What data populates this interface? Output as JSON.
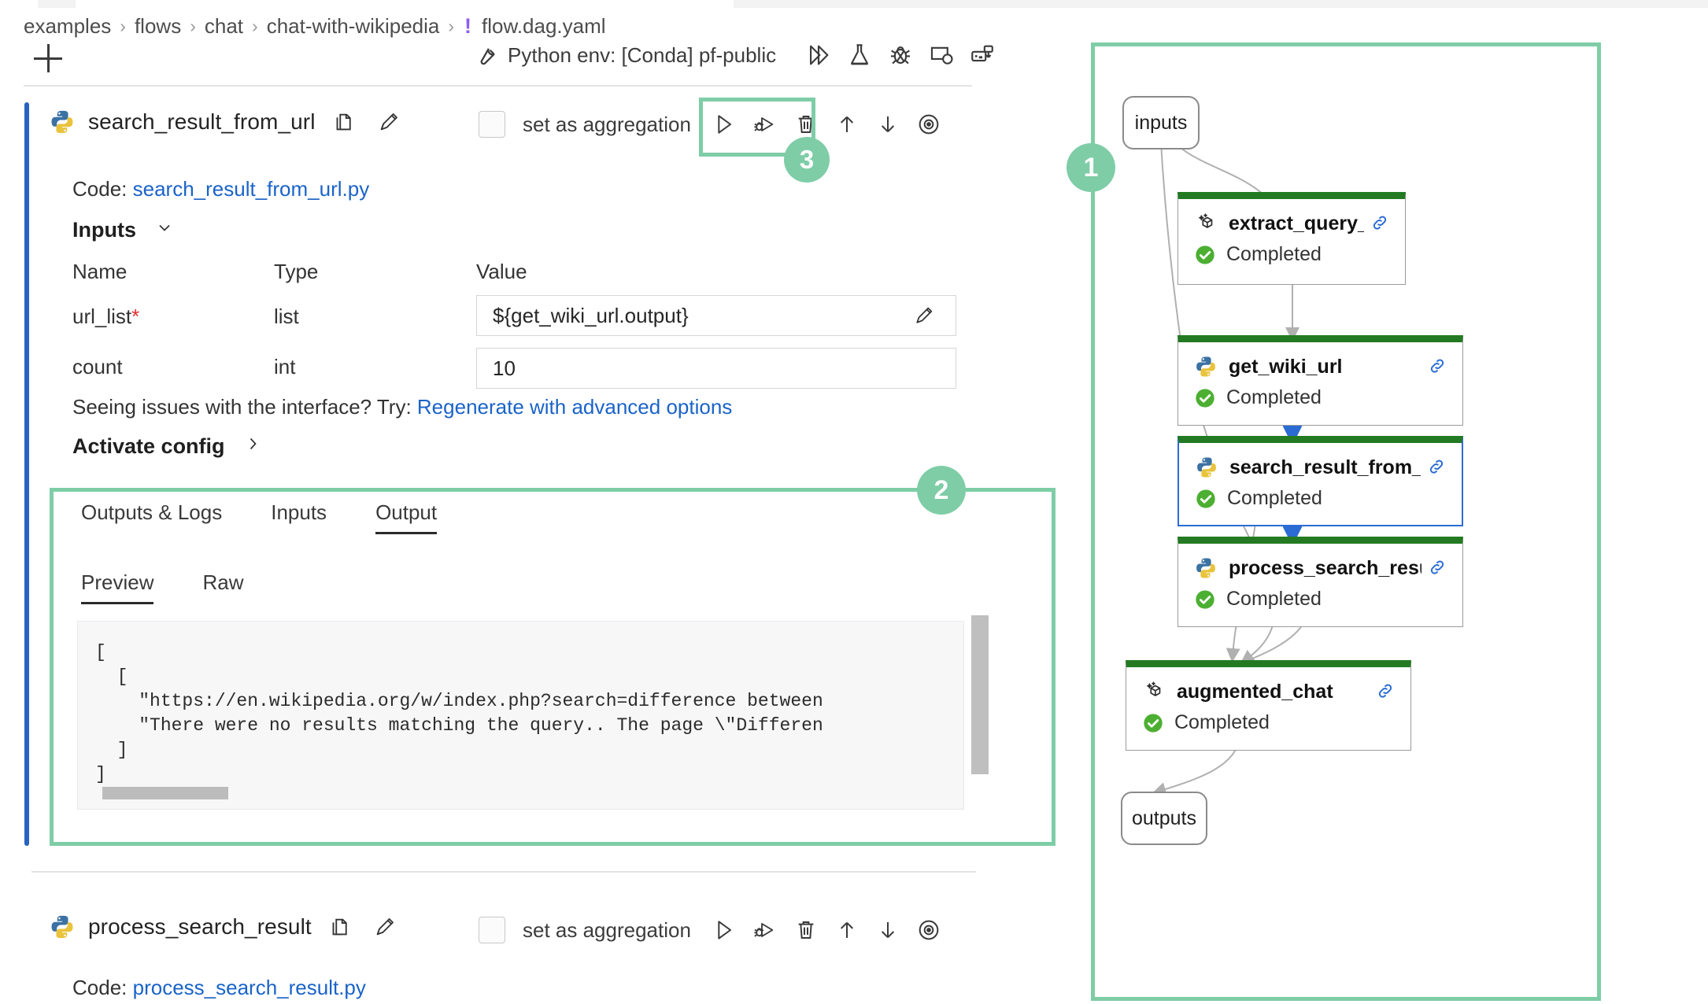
{
  "breadcrumb": {
    "items": [
      "examples",
      "flows",
      "chat",
      "chat-with-wikipedia"
    ],
    "separator": "›",
    "warning_glyph": "!",
    "file": "flow.dag.yaml"
  },
  "toolbar": {
    "add_label": "+",
    "env_label": "Python env: [Conda] pf-public",
    "icons": [
      {
        "name": "run-all-icon",
        "glyph": "run"
      },
      {
        "name": "flask-icon",
        "glyph": "flask"
      },
      {
        "name": "bug-icon",
        "glyph": "bug"
      },
      {
        "name": "monitor-icon",
        "glyph": "monitor"
      },
      {
        "name": "export-icon",
        "glyph": "export"
      }
    ]
  },
  "node": {
    "name": "search_result_from_url",
    "code_label": "Code:",
    "code_file": "search_result_from_url.py",
    "aggregation_label": "set as aggregation",
    "aggregation_checked": false,
    "inputs_section": {
      "title": "Inputs",
      "columns": [
        "Name",
        "Type",
        "Value"
      ],
      "rows": [
        {
          "name": "url_list",
          "required": true,
          "type": "list",
          "value": "${get_wiki_url.output}",
          "has_edit": true
        },
        {
          "name": "count",
          "required": false,
          "type": "int",
          "value": "10",
          "has_edit": false
        }
      ]
    },
    "hint_prefix": "Seeing issues with the interface? Try:",
    "hint_link": "Regenerate with advanced options",
    "activate_config": "Activate config"
  },
  "output_panel": {
    "tabs": [
      {
        "label": "Outputs & Logs",
        "active": false
      },
      {
        "label": "Inputs",
        "active": false
      },
      {
        "label": "Output",
        "active": true
      }
    ],
    "subtabs": [
      {
        "label": "Preview",
        "active": true
      },
      {
        "label": "Raw",
        "active": false
      }
    ],
    "content": "[\n  [\n    \"https://en.wikipedia.org/w/index.php?search=difference between\n    \"There were no results matching the query.. The page \\\"Differen\n  ]\n]"
  },
  "node2": {
    "name": "process_search_result",
    "code_label": "Code:",
    "code_file": "process_search_result.py",
    "aggregation_label": "set as aggregation",
    "aggregation_checked": false
  },
  "annotations": [
    {
      "id": "1",
      "label": "1"
    },
    {
      "id": "2",
      "label": "2"
    },
    {
      "id": "3",
      "label": "3"
    }
  ],
  "graph": {
    "input_node": "inputs",
    "output_node": "outputs",
    "status_label": "Completed",
    "nodes": [
      {
        "name": "extract_query_from_...",
        "icon": "llm",
        "status": "Completed",
        "selected": false
      },
      {
        "name": "get_wiki_url",
        "icon": "python",
        "status": "Completed",
        "selected": false
      },
      {
        "name": "search_result_from_...",
        "icon": "python",
        "status": "Completed",
        "selected": true
      },
      {
        "name": "process_search_result",
        "icon": "python",
        "status": "Completed",
        "selected": false
      },
      {
        "name": "augmented_chat",
        "icon": "llm",
        "status": "Completed",
        "selected": false
      }
    ]
  },
  "colors": {
    "accent_green": "#7ecda6",
    "node_status_green": "#237a22",
    "selected_blue": "#2b6cd4",
    "left_bar_blue": "#2863c2",
    "link_blue": "#1a63c8",
    "required_red": "#e03131",
    "breadcrumb_warning_purple": "#8b5cf6"
  }
}
